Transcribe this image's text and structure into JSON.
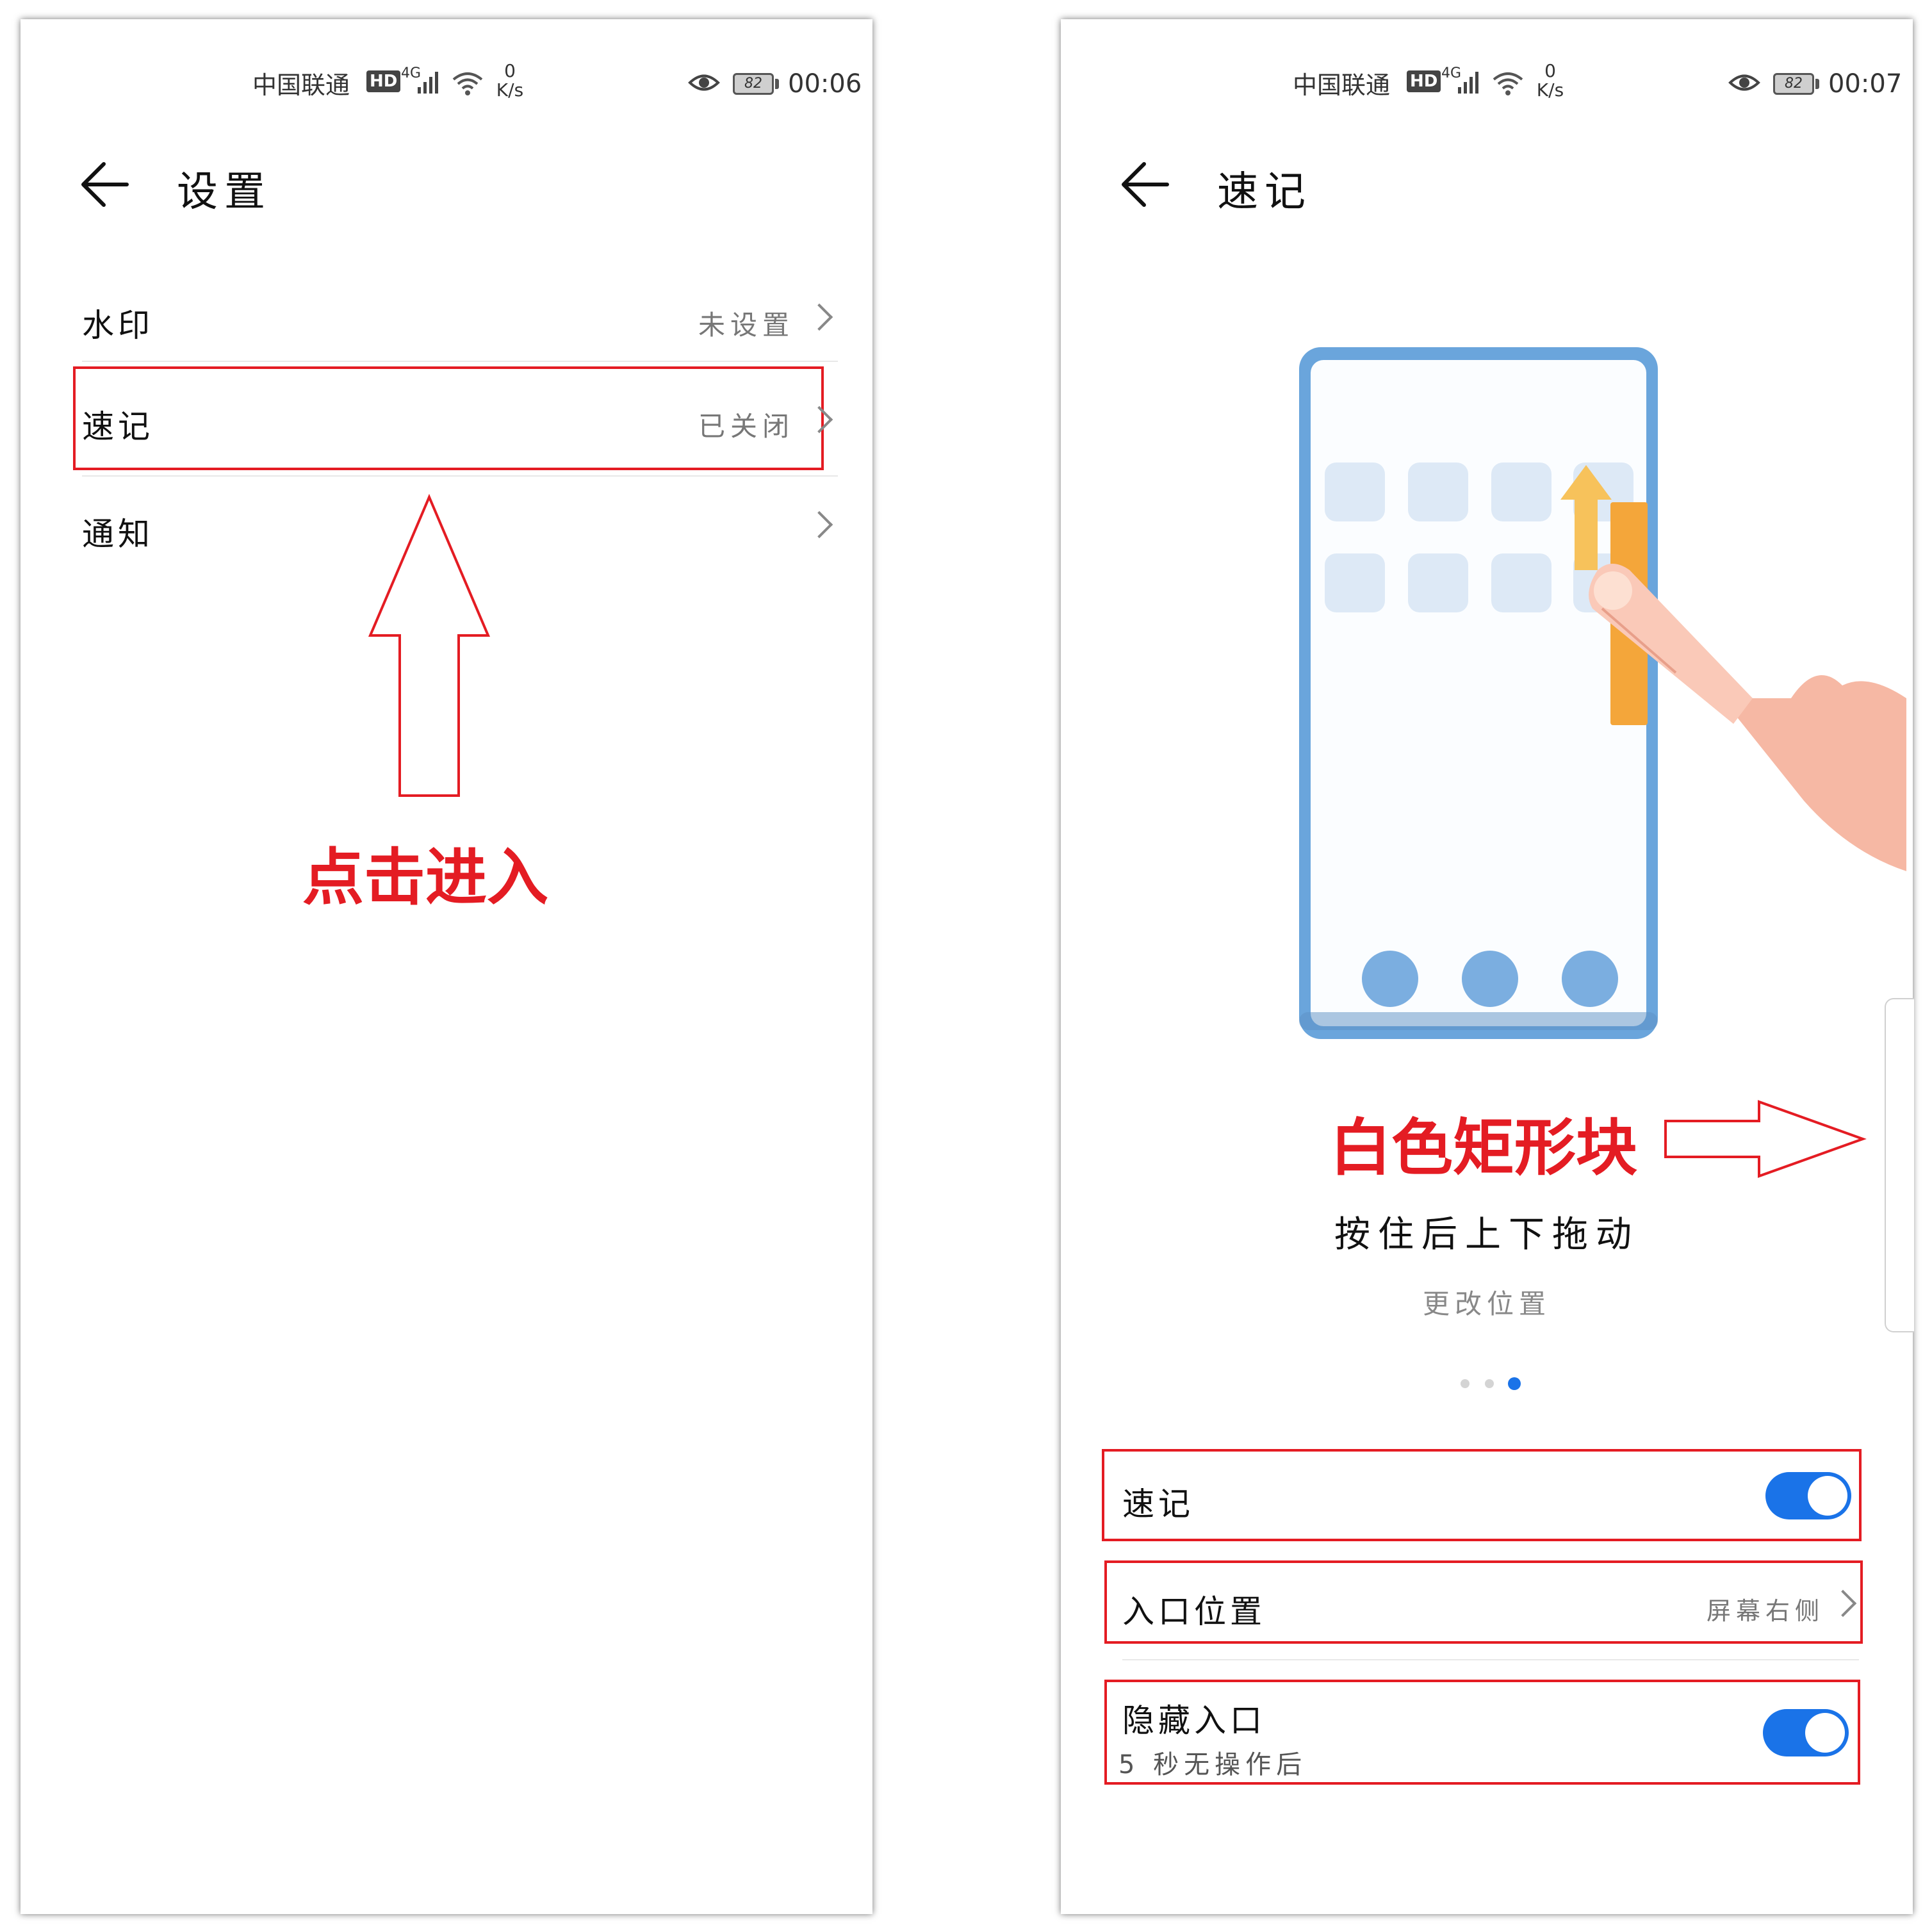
{
  "left": {
    "status_bar": {
      "carrier": "中国联通",
      "hd": "HD",
      "network": "4G",
      "speed_value": "0",
      "speed_unit": "K/s",
      "battery": "82",
      "time": "00:06",
      "icons": [
        "hd-icon",
        "signal-icon",
        "wifi-icon",
        "eye-comfort-icon",
        "battery-icon"
      ]
    },
    "header": {
      "back_icon": "back-arrow-icon",
      "title": "设置"
    },
    "rows": [
      {
        "label": "水印",
        "value": "未设置"
      },
      {
        "label": "速记",
        "value": "已关闭"
      },
      {
        "label": "通知",
        "value": ""
      }
    ],
    "annotation": {
      "text": "点击进入",
      "color": "#e41c23"
    }
  },
  "right": {
    "status_bar": {
      "carrier": "中国联通",
      "hd": "HD",
      "network": "4G",
      "speed_value": "0",
      "speed_unit": "K/s",
      "battery": "82",
      "time": "00:07"
    },
    "header": {
      "back_icon": "back-arrow-icon",
      "title": "速记"
    },
    "illustration": {
      "name": "phone-swipe-illustration",
      "accent": "#f4a63a",
      "frame": "#6aa5dc"
    },
    "annotation": {
      "text": "白色矩形块",
      "color": "#e41c23"
    },
    "description": {
      "main": "按住后上下拖动",
      "sub": "更改位置"
    },
    "pager": {
      "count": 3,
      "active": 3
    },
    "settings": [
      {
        "label": "速记",
        "toggle": true
      },
      {
        "label": "入口位置",
        "value": "屏幕右侧"
      },
      {
        "label": "隐藏入口",
        "sublabel": "5 秒无操作后",
        "toggle": true
      }
    ],
    "accent_color": "#1a73e8"
  }
}
